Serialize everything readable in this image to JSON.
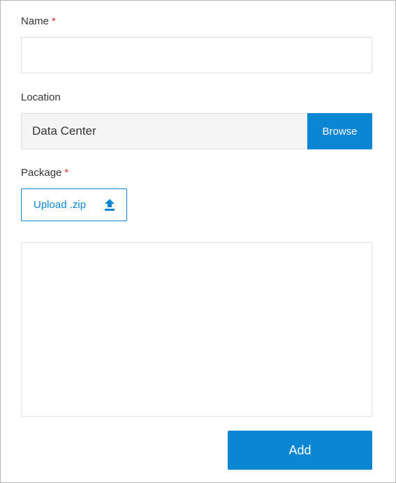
{
  "form": {
    "name": {
      "label": "Name",
      "required_mark": "*",
      "value": "",
      "placeholder": ""
    },
    "location": {
      "label": "Location",
      "value": "Data Center",
      "browse_label": "Browse"
    },
    "package": {
      "label": "Package",
      "required_mark": "*",
      "upload_label": "Upload .zip",
      "upload_icon": "upload-icon"
    },
    "add_label": "Add"
  },
  "colors": {
    "accent": "#0a86d2",
    "required": "#d32f2f",
    "readonly_bg": "#f5f5f5",
    "border": "#dcdcdc"
  }
}
